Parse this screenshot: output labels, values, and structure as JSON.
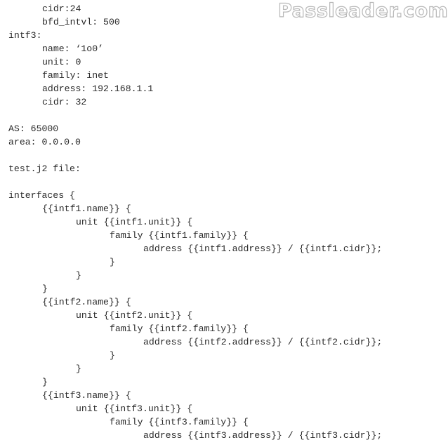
{
  "watermark": "Passleader.com",
  "lines": [
    {
      "indent": 1,
      "text": "cidr:24"
    },
    {
      "indent": 1,
      "text": "bfd_intvl: 500"
    },
    {
      "indent": 0,
      "text": "intf3:"
    },
    {
      "indent": 1,
      "text": "name: ‘1o0’"
    },
    {
      "indent": 1,
      "text": "unit: 0"
    },
    {
      "indent": 1,
      "text": "family: inet"
    },
    {
      "indent": 1,
      "text": "address: 192.168.1.1"
    },
    {
      "indent": 1,
      "text": "cidr: 32"
    },
    {
      "indent": 0,
      "text": ""
    },
    {
      "indent": 0,
      "text": "AS: 65000"
    },
    {
      "indent": 0,
      "text": "area: 0.0.0.0"
    },
    {
      "indent": 0,
      "text": ""
    },
    {
      "indent": 0,
      "text": "test.j2 file:"
    },
    {
      "indent": 0,
      "text": ""
    },
    {
      "indent": 0,
      "text": "interfaces {"
    },
    {
      "indent": 1,
      "text": "{{intf1.name}} {"
    },
    {
      "indent": 2,
      "text": "unit {{intf1.unit}} {"
    },
    {
      "indent": 3,
      "text": "family {{intf1.family}} {"
    },
    {
      "indent": 4,
      "text": "address {{intf1.address}} / {{intf1.cidr}};"
    },
    {
      "indent": 3,
      "text": "}"
    },
    {
      "indent": 2,
      "text": "}"
    },
    {
      "indent": 1,
      "text": "}"
    },
    {
      "indent": 1,
      "text": "{{intf2.name}} {"
    },
    {
      "indent": 2,
      "text": "unit {{intf2.unit}} {"
    },
    {
      "indent": 3,
      "text": "family {{intf2.family}} {"
    },
    {
      "indent": 4,
      "text": "address {{intf2.address}} / {{intf2.cidr}};"
    },
    {
      "indent": 3,
      "text": "}"
    },
    {
      "indent": 2,
      "text": "}"
    },
    {
      "indent": 1,
      "text": "}"
    },
    {
      "indent": 1,
      "text": "{{intf3.name}} {"
    },
    {
      "indent": 2,
      "text": "unit {{intf3.unit}} {"
    },
    {
      "indent": 3,
      "text": "family {{intf3.family}} {"
    },
    {
      "indent": 4,
      "text": "address {{intf3.address}} / {{intf3.cidr}};"
    }
  ]
}
